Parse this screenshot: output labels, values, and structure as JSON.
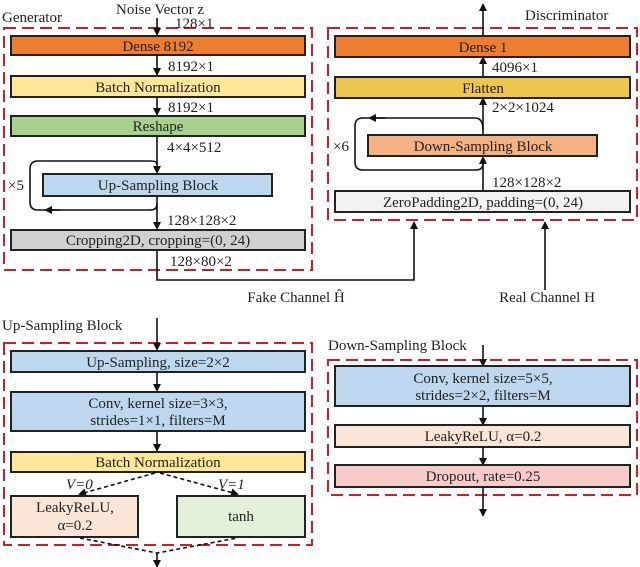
{
  "colors": {
    "dense": "#ed7d31",
    "batch_norm": "#ffe699",
    "reshape": "#a9d18e",
    "up_sampling": "#bdd7ee",
    "cropping": "#d0d0d0",
    "flatten": "#ecc64e",
    "down_sampling": "#f4b183",
    "zero_padding": "#f2f2f2",
    "leaky_relu": "#fbe5d6",
    "tanh": "#e2f0d9",
    "dropout": "#f8cbcb",
    "frame": "#c8202a"
  },
  "generator": {
    "title": "Generator",
    "input": "Noise Vector z",
    "input_dim": "128×1",
    "dense": "Dense 8192",
    "dim1": "8192×1",
    "bn": "Batch Normalization",
    "dim2": "8192×1",
    "reshape": "Reshape",
    "dim3": "4×4×512",
    "repeat": "×5",
    "up_block": "Up-Sampling Block",
    "dim4": "128×128×2",
    "crop": "Cropping2D, cropping=(0, 24)",
    "dim5": "128×80×2"
  },
  "discriminator": {
    "title": "Discriminator",
    "dense": "Dense 1",
    "dim1": "4096×1",
    "flatten": "Flatten",
    "dim2": "2×2×1024",
    "repeat": "×6",
    "down_block": "Down-Sampling Block",
    "dim3": "128×128×2",
    "pad": "ZeroPadding2D, padding=(0, 24)"
  },
  "channels": {
    "fake": "Fake Channel Ĥ",
    "real": "Real Channel H"
  },
  "up_sampling_block": {
    "title": "Up-Sampling Block",
    "upsample": "Up-Sampling, size=2×2",
    "conv_line1": "Conv, kernel size=3×3,",
    "conv_line2": "strides=1×1, filters=M",
    "bn": "Batch Normalization",
    "v0": "V=0",
    "v1": "V=1",
    "leaky_line1": "LeakyReLU,",
    "leaky_line2": "α=0.2",
    "tanh": "tanh"
  },
  "down_sampling_block": {
    "title": "Down-Sampling Block",
    "conv_line1": "Conv, kernel size=5×5,",
    "conv_line2": "strides=2×2, filters=M",
    "leaky": "LeakyReLU, α=0.2",
    "dropout": "Dropout, rate=0.25"
  }
}
